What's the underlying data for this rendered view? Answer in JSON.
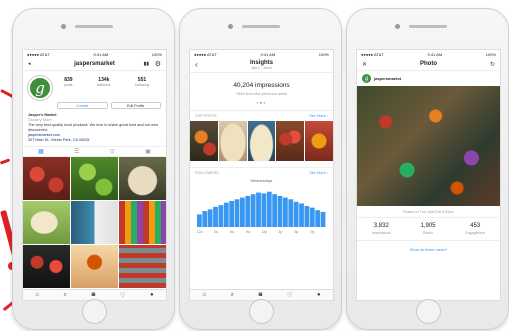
{
  "status": {
    "carrier": "●●●●● AT&T",
    "time": "9:41 AM",
    "battery": "100%"
  },
  "profile": {
    "username": "jaspersmarket",
    "stats": [
      {
        "value": "839",
        "label": "posts"
      },
      {
        "value": "134k",
        "label": "followers"
      },
      {
        "value": "551",
        "label": "following"
      }
    ],
    "contact_label": "Contact",
    "edit_label": "Edit Profile",
    "bio_name": "Jasper's Market",
    "bio_category": "Grocery Store",
    "bio_text": "The very best quality local products. We love to share great food and our new discoveries.",
    "bio_url": "jaspersmarket.com",
    "bio_address": "307 Main St., Menlo Park, CA 94025",
    "avatar_letter": "g"
  },
  "insights": {
    "title": "Insights",
    "subtitle": "Jun 1 - Jun 8",
    "impressions_value": "40,204 impressions",
    "impressions_delta": "+845 from the previous week",
    "top_posts_label": "TOP POSTS",
    "see_more": "See More ›",
    "followers_label": "FOLLOWERS",
    "chart_title": "Wednesdays",
    "time_labels": [
      "12a",
      "3a",
      "6a",
      "9a",
      "12p",
      "3p",
      "6p",
      "9p"
    ]
  },
  "photo": {
    "title": "Photo",
    "username": "jaspersmarket",
    "posted": "Posted on Tue, April 5 at 8:52pm",
    "metrics": [
      {
        "value": "3,832",
        "label": "Impressions"
      },
      {
        "value": "1,905",
        "label": "Reach"
      },
      {
        "value": "453",
        "label": "Engagement"
      }
    ],
    "what_are": "What do these mean?"
  },
  "chart_data": {
    "type": "bar",
    "title": "Wednesdays",
    "categories": [
      "12a",
      "",
      "",
      "3a",
      "",
      "",
      "6a",
      "",
      "",
      "9a",
      "",
      "",
      "12p",
      "",
      "",
      "3p",
      "",
      "",
      "6p",
      "",
      "",
      "9p",
      "",
      ""
    ],
    "values": [
      30,
      38,
      42,
      48,
      52,
      58,
      62,
      66,
      70,
      74,
      78,
      82,
      80,
      84,
      78,
      74,
      70,
      66,
      60,
      56,
      50,
      46,
      40,
      36
    ],
    "ylim": [
      0,
      100
    ],
    "colors": {
      "bar": "#3897f0"
    }
  }
}
